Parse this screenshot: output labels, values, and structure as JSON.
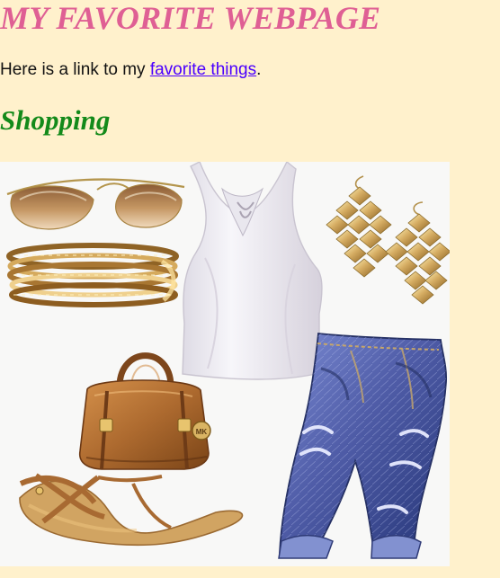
{
  "header": {
    "title": "MY FAVORITE WEBPAGE"
  },
  "intro": {
    "prefix": "Here is a link to my ",
    "link_text": "favorite things",
    "suffix": "."
  },
  "section": {
    "title": "Shopping"
  },
  "collage": {
    "items": [
      {
        "name": "sunglasses"
      },
      {
        "name": "bangles"
      },
      {
        "name": "white-tank-top"
      },
      {
        "name": "gold-earrings"
      },
      {
        "name": "brown-handbag"
      },
      {
        "name": "brown-sandals"
      },
      {
        "name": "distressed-jeans"
      }
    ],
    "colors": {
      "page_bg": "#fff1cc",
      "title": "#df5f94",
      "link": "#4b00ff",
      "section_title": "#138a1a",
      "collage_bg": "#f8f8f7",
      "gold": "#c89c4b",
      "leather": "#b46b2e",
      "denim": "#4e5ea8"
    },
    "handbag_logo": "MK"
  }
}
